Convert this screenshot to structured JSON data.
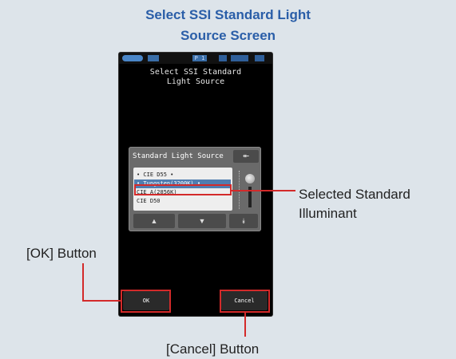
{
  "heading": {
    "line1": "Select SSI Standard Light",
    "line2": "Source Screen"
  },
  "screen": {
    "status": {
      "page": "P 1"
    },
    "title_line1": "Select SSI Standard",
    "title_line2": "Light Source",
    "dialog": {
      "header": "Standard Light Source",
      "top_button_icon": "⯬",
      "items": [
        "• CIE D55 •",
        "• Tungsten(3200K) •",
        "CIE A(2856K)",
        "CIE D50"
      ],
      "selected_index": 1,
      "nav": {
        "up_icon": "▲",
        "down_icon": "▼",
        "bottom_icon": "⯯"
      }
    },
    "buttons": {
      "ok": "OK",
      "cancel": "Cancel"
    }
  },
  "callouts": {
    "selected_line1": "Selected Standard",
    "selected_line2": "Illuminant",
    "ok_label": "[OK] Button",
    "cancel_label": "[Cancel] Button"
  },
  "colors": {
    "heading": "#2a5ea8",
    "highlight": "#d32a2a",
    "selected_row": "#4f7db0",
    "background": "#dde4ea"
  }
}
